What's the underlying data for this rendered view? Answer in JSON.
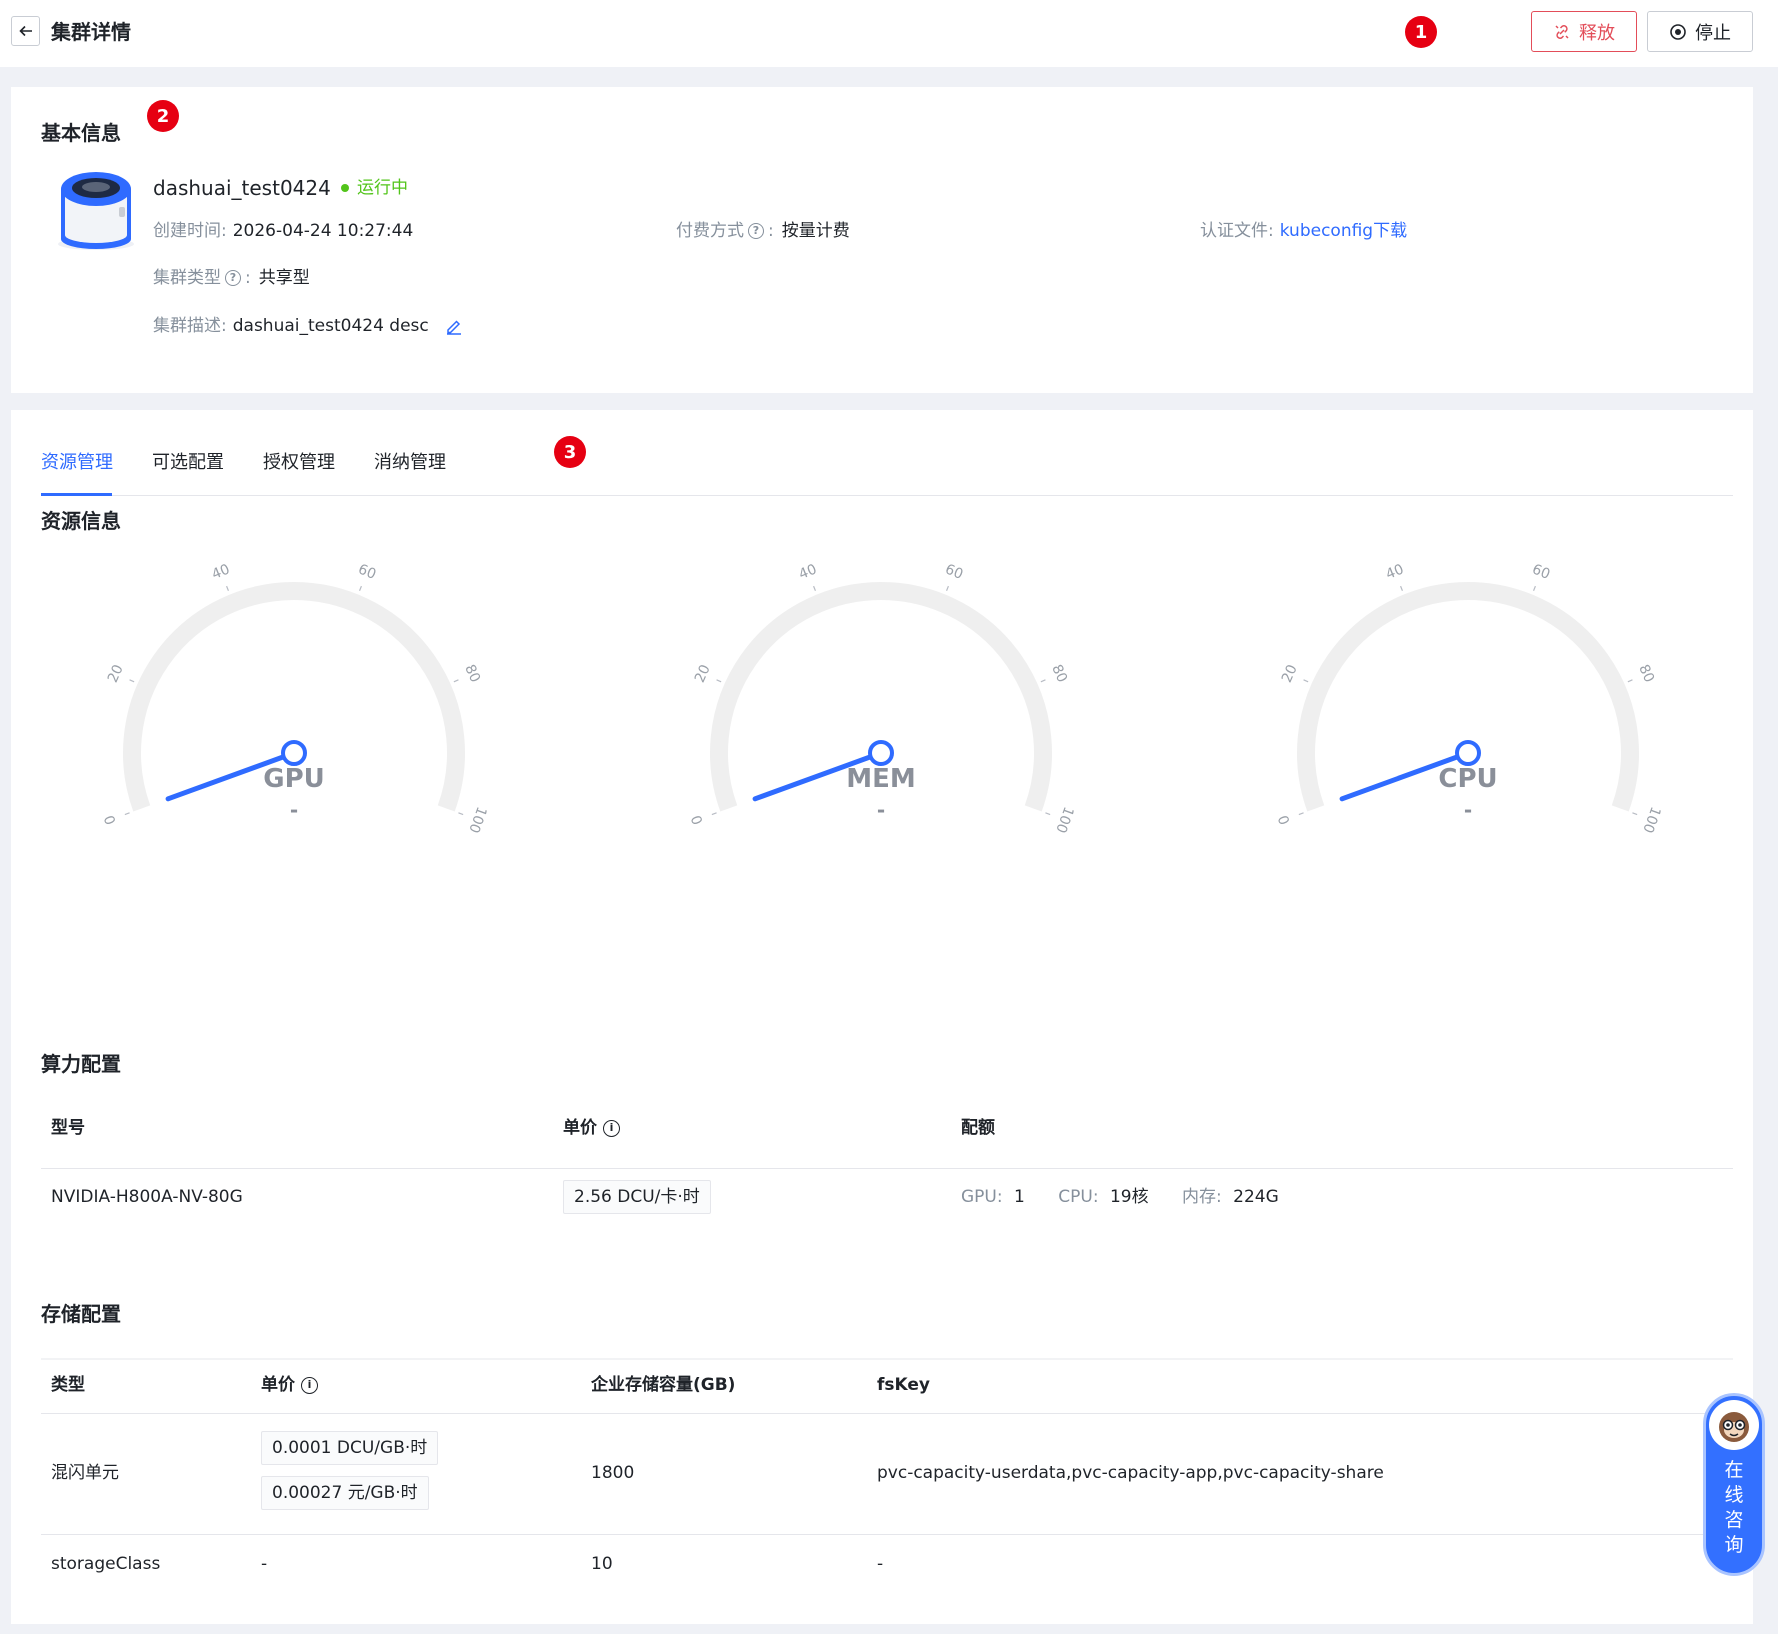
{
  "header": {
    "title": "集群详情",
    "release_label": "释放",
    "stop_label": "停止"
  },
  "badges": [
    "1",
    "2",
    "3"
  ],
  "basic": {
    "section_title": "基本信息",
    "cluster_name": "dashuai_test0424",
    "status": "运行中",
    "created_key": "创建时间:",
    "created_value": "2026-04-24 10:27:44",
    "billing_key": "付费方式",
    "billing_value": "按量计费",
    "auth_key": "认证文件:",
    "auth_value": "kubeconfig下载",
    "type_key": "集群类型",
    "type_value": "共享型",
    "desc_key": "集群描述:",
    "desc_value": "dashuai_test0424 desc",
    "colon": ":"
  },
  "tabs": [
    "资源管理",
    "可选配置",
    "授权管理",
    "消纳管理"
  ],
  "resource": {
    "section_title": "资源信息",
    "gauges": [
      {
        "label": "GPU",
        "value_text": "-",
        "value": 0
      },
      {
        "label": "MEM",
        "value_text": "-",
        "value": 0
      },
      {
        "label": "CPU",
        "value_text": "-",
        "value": 0
      }
    ],
    "ticks": [
      "0",
      "20",
      "40",
      "60",
      "80",
      "100"
    ]
  },
  "compute": {
    "section_title": "算力配置",
    "headers": [
      "型号",
      "单价",
      "配额"
    ],
    "model": "NVIDIA-H800A-NV-80G",
    "price": "2.56 DCU/卡·时",
    "quota": {
      "gpu_key": "GPU:",
      "gpu_value": "1",
      "cpu_key": "CPU:",
      "cpu_value": "19核",
      "mem_key": "内存:",
      "mem_value": "224G"
    }
  },
  "storage": {
    "section_title": "存储配置",
    "headers": [
      "类型",
      "单价",
      "企业存储容量(GB)",
      "fsKey"
    ],
    "rows": [
      {
        "type": "混闪单元",
        "prices": [
          "0.0001 DCU/GB·时",
          "0.00027 元/GB·时"
        ],
        "capacity": "1800",
        "fskey": "pvc-capacity-userdata,pvc-capacity-app,pvc-capacity-share"
      },
      {
        "type": "storageClass",
        "price": "-",
        "capacity": "10",
        "fskey": "-"
      }
    ]
  },
  "consult": {
    "label": "在线咨询"
  },
  "colors": {
    "accent": "#2f6bff",
    "danger": "#e34d59",
    "success": "#52c41a",
    "badge": "#e60012"
  }
}
